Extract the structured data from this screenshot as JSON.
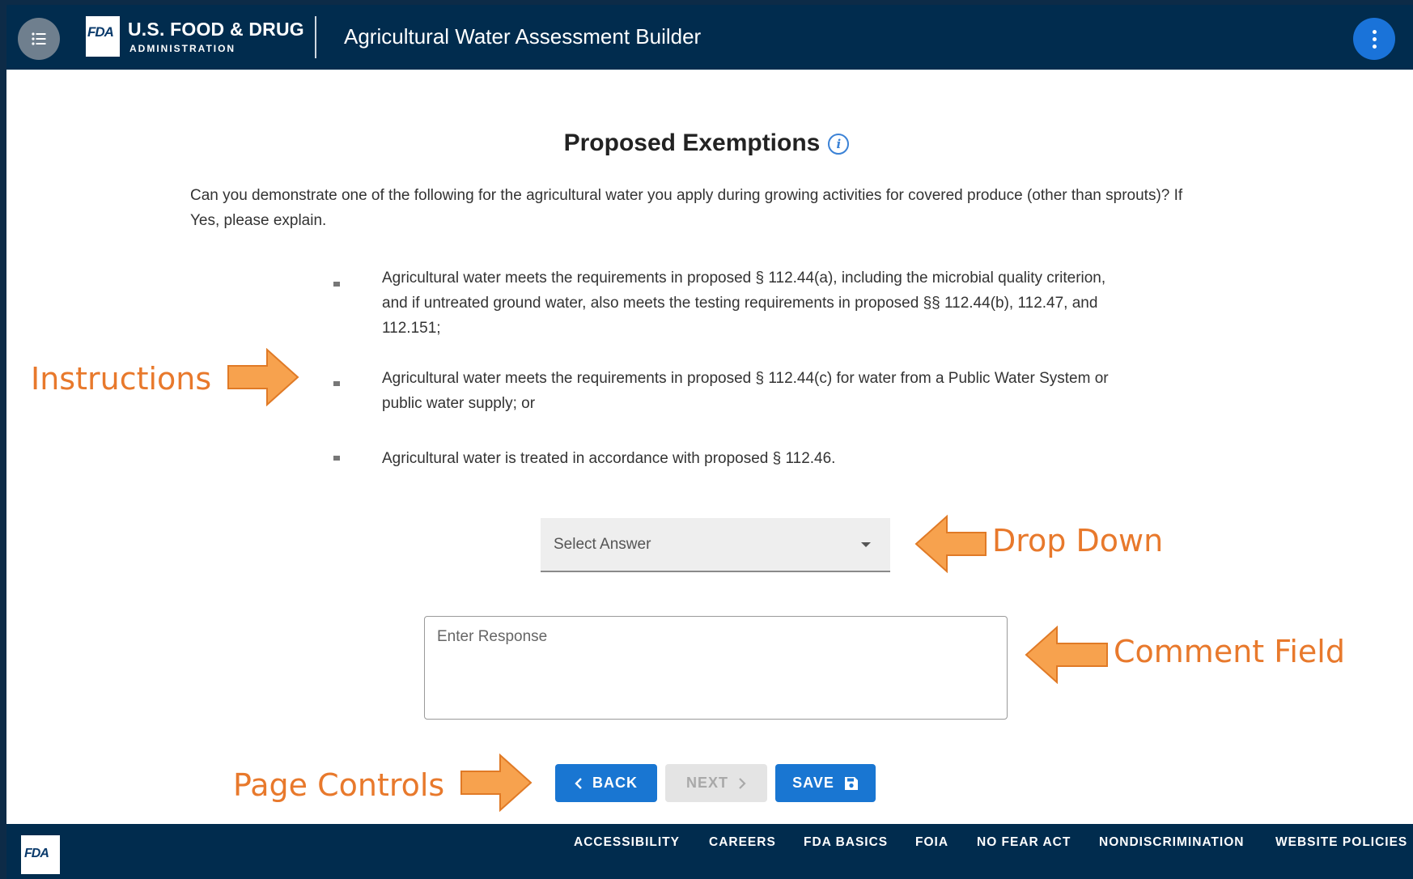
{
  "header": {
    "brand_title": "U.S. FOOD & DRUG",
    "brand_subtitle": "ADMINISTRATION",
    "logo_text": "FDA",
    "app_title": "Agricultural Water Assessment Builder",
    "menu_icon": "list-menu-icon",
    "more_icon": "more-vertical-icon",
    "colors": {
      "bar": "#012c4e",
      "more_button": "#1a73d9"
    }
  },
  "main": {
    "section_title": "Proposed Exemptions",
    "info_icon_glyph": "i",
    "question": "Can you demonstrate one of the following for the agricultural water you apply during growing activities for covered produce (other than sprouts)? If Yes, please explain.",
    "bullets": [
      "Agricultural water meets the requirements in proposed § 112.44(a), including the microbial quality criterion, and if untreated ground water, also meets the testing requirements in proposed §§ 112.44(b), 112.47, and 112.151;",
      "Agricultural water meets the requirements in proposed § 112.44(c) for water from a Public Water System or public water supply; or",
      "Agricultural water is treated in accordance with proposed § 112.46."
    ],
    "select": {
      "value": "Select Answer"
    },
    "response": {
      "placeholder": "Enter Response",
      "value": ""
    },
    "controls": {
      "back_label": "BACK",
      "next_label": "NEXT",
      "save_label": "SAVE",
      "back_icon": "chevron-left-icon",
      "next_icon": "chevron-right-icon",
      "save_icon": "floppy-disk-icon",
      "accent": "#1976d2"
    }
  },
  "annotations": {
    "instructions": "Instructions",
    "drop_down": "Drop Down",
    "comment_field": "Comment Field",
    "page_controls": "Page Controls",
    "color": "#e8792c"
  },
  "footer": {
    "logo_text": "FDA",
    "links": [
      "ACCESSIBILITY",
      "CAREERS",
      "FDA BASICS",
      "FOIA",
      "NO FEAR ACT",
      "NONDISCRIMINATION",
      "WEBSITE POLICIES"
    ]
  }
}
